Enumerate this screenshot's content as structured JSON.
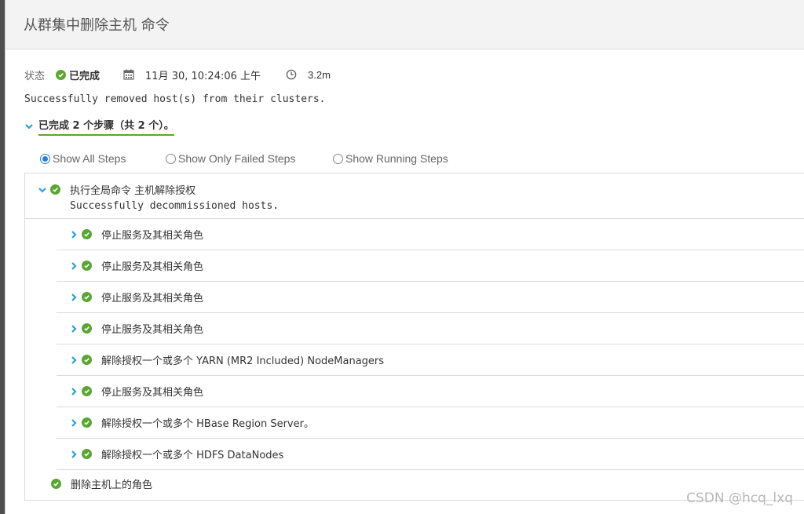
{
  "modal": {
    "title": "从群集中删除主机 命令"
  },
  "status": {
    "label": "状态",
    "value": "已完成",
    "date": "11月 30, 10:24:06 上午",
    "duration": "3.2m"
  },
  "message": "Successfully removed host(s) from their clusters.",
  "summary": "已完成 2 个步骤（共 2 个）。",
  "filters": [
    {
      "label": "Show All Steps",
      "selected": true
    },
    {
      "label": "Show Only Failed Steps",
      "selected": false
    },
    {
      "label": "Show Running Steps",
      "selected": false
    }
  ],
  "steps": {
    "top": {
      "title": "执行全局命令 主机解除授权",
      "message": "Successfully decommissioned hosts."
    },
    "children": [
      {
        "label": "停止服务及其相关角色"
      },
      {
        "label": "停止服务及其相关角色"
      },
      {
        "label": "停止服务及其相关角色"
      },
      {
        "label": "停止服务及其相关角色"
      },
      {
        "label": "解除授权一个或多个 YARN (MR2 Included) NodeManagers"
      },
      {
        "label": "停止服务及其相关角色"
      },
      {
        "label": "解除授权一个或多个 HBase Region Server。"
      },
      {
        "label": "解除授权一个或多个 HDFS DataNodes"
      }
    ],
    "last": {
      "title": "删除主机上的角色"
    }
  },
  "watermark": "CSDN @hcq_lxq",
  "colors": {
    "success": "#5aa533",
    "chevron": "#2a9fd6",
    "radio": "#2a7fd1"
  },
  "icons": {
    "status": "check-circle-icon",
    "date": "calendar-icon",
    "duration": "clock-icon",
    "expand": "chevron-down-icon",
    "collapsed": "chevron-right-icon"
  }
}
